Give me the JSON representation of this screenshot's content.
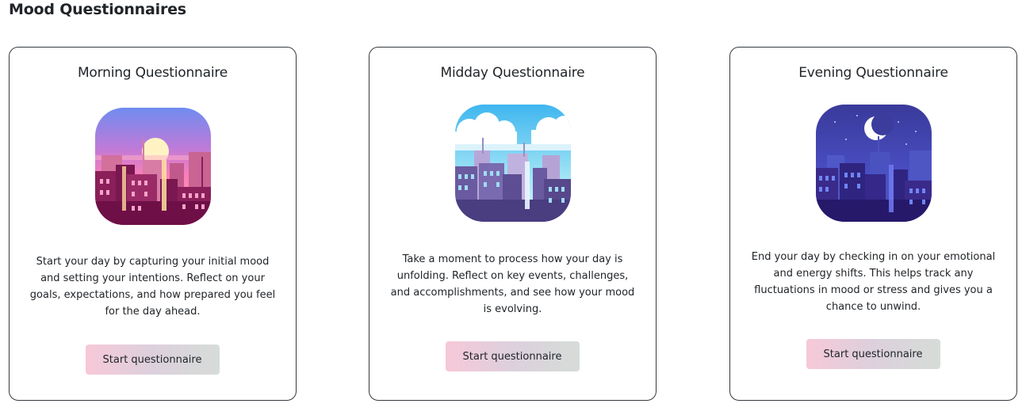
{
  "page": {
    "title": "Mood Questionnaires"
  },
  "cards": [
    {
      "title": "Morning Questionnaire",
      "illustration": "sunrise-city-icon",
      "description": "Start your day by capturing your initial mood and setting your intentions. Reflect on your goals, expectations, and how prepared you feel for the day ahead.",
      "button_label": "Start questionnaire"
    },
    {
      "title": "Midday Questionnaire",
      "illustration": "daytime-city-icon",
      "description": "Take a moment to process how your day is unfolding. Reflect on key events, challenges, and accomplishments, and see how your mood is evolving.",
      "button_label": "Start questionnaire"
    },
    {
      "title": "Evening Questionnaire",
      "illustration": "night-city-icon",
      "description": "End your day by checking in on your emotional and energy shifts. This helps track any fluctuations in mood or stress and gives you a chance to unwind.",
      "button_label": "Start questionnaire"
    }
  ],
  "colors": {
    "button_gradient": [
      "#f7c8d8",
      "#dcd0dc",
      "#d6dcd8"
    ],
    "card_border": "#343a40"
  }
}
